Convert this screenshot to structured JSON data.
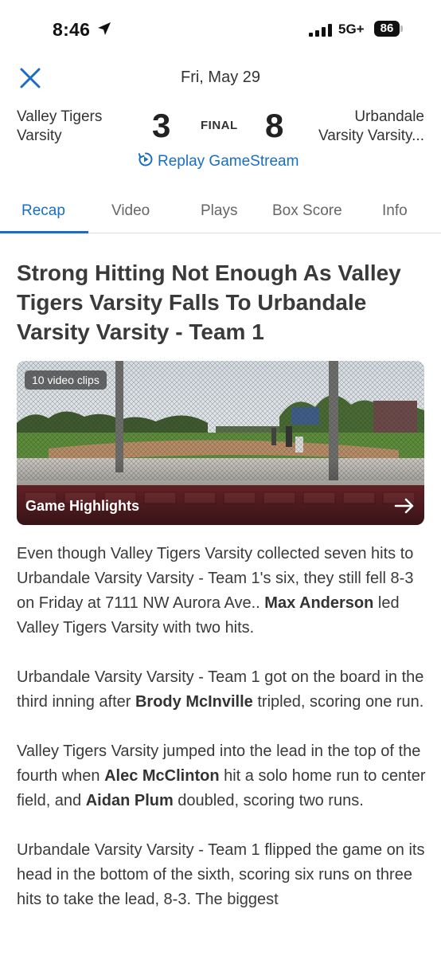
{
  "status": {
    "time": "8:46",
    "network": "5G+",
    "battery": "86"
  },
  "header": {
    "date": "Fri, May 29",
    "home_team_line1": "Valley Tigers",
    "home_team_line2": "Varsity",
    "home_score": "3",
    "status": "FINAL",
    "away_score": "8",
    "away_team_line1": "Urbandale",
    "away_team_line2": "Varsity Varsity...",
    "replay_label": "Replay GameStream"
  },
  "tabs": [
    "Recap",
    "Video",
    "Plays",
    "Box Score",
    "Info"
  ],
  "article": {
    "headline": "Strong Hitting Not Enough As Valley Tigers Varsity Falls To Urbandale Varsity Varsity - Team 1",
    "video": {
      "clips_badge": "10 video clips",
      "title": "Game Highlights"
    },
    "p1": {
      "a": "Even though Valley Tigers Varsity collected seven hits to Urbandale Varsity Varsity - Team 1's six, they still fell 8-3 on Friday at 7111 NW Aurora Ave.. ",
      "b": "Max Anderson",
      "c": " led Valley Tigers Varsity with two hits."
    },
    "p2": {
      "a": "Urbandale Varsity Varsity - Team 1 got on the board in the third inning after ",
      "b": "Brody McInville",
      "c": " tripled, scoring one run."
    },
    "p3": {
      "a": "Valley Tigers Varsity jumped into the lead in the top of the fourth when ",
      "b": "Alec McClinton",
      "c": " hit a solo home run to center field, and ",
      "d": "Aidan Plum",
      "e": " doubled, scoring two runs."
    },
    "p4": {
      "a": "Urbandale Varsity Varsity - Team 1 flipped the game on its head in the bottom of the sixth, scoring six runs on three hits to take the lead, 8-3. The biggest"
    }
  },
  "colors": {
    "accent": "#1a6ec2",
    "text": "#3a3a3a"
  },
  "icons": [
    "location-arrow-icon",
    "signal-icon",
    "close-icon",
    "replay-icon",
    "arrow-right-icon"
  ]
}
